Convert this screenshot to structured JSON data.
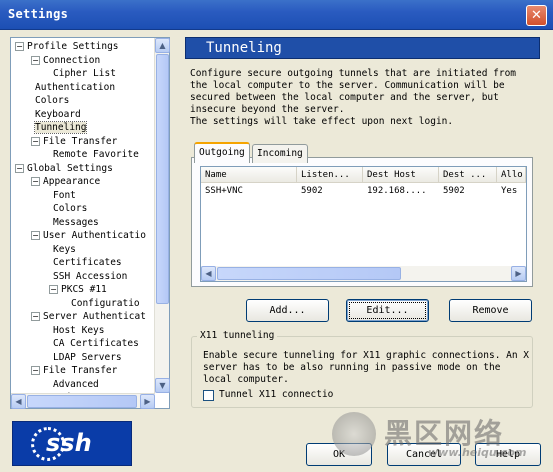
{
  "window": {
    "title": "Settings",
    "close_glyph": "✕"
  },
  "tree": {
    "items": [
      {
        "label": "Profile Settings",
        "expander": "−"
      },
      {
        "label": "Connection",
        "expander": "−"
      },
      {
        "label": "Cipher List",
        "expander": ""
      },
      {
        "label": "Authentication",
        "expander": ""
      },
      {
        "label": "Colors",
        "expander": ""
      },
      {
        "label": "Keyboard",
        "expander": ""
      },
      {
        "label": "Tunneling",
        "expander": "",
        "selected": true
      },
      {
        "label": "File Transfer",
        "expander": "−"
      },
      {
        "label": "Remote Favorite",
        "expander": ""
      },
      {
        "label": "Global Settings",
        "expander": "−"
      },
      {
        "label": "Appearance",
        "expander": "−"
      },
      {
        "label": "Font",
        "expander": ""
      },
      {
        "label": "Colors",
        "expander": ""
      },
      {
        "label": "Messages",
        "expander": ""
      },
      {
        "label": "User Authenticatio",
        "expander": "−"
      },
      {
        "label": "Keys",
        "expander": ""
      },
      {
        "label": "Certificates",
        "expander": ""
      },
      {
        "label": "SSH Accession",
        "expander": ""
      },
      {
        "label": "PKCS #11",
        "expander": "−"
      },
      {
        "label": "Configuratio",
        "expander": ""
      },
      {
        "label": "Server Authenticat",
        "expander": "−"
      },
      {
        "label": "Host Keys",
        "expander": ""
      },
      {
        "label": "CA Certificates",
        "expander": ""
      },
      {
        "label": "LDAP Servers",
        "expander": ""
      },
      {
        "label": "File Transfer",
        "expander": "−"
      },
      {
        "label": "Advanced",
        "expander": ""
      },
      {
        "label": "Mode",
        "expander": ""
      }
    ]
  },
  "logo": {
    "text": "ssh"
  },
  "panel": {
    "title": "Tunneling",
    "description": "Configure secure outgoing tunnels that are initiated from\nthe local computer to the server. Communication will be\nsecured between the local computer and the server, but\ninsecure beyond the server.\nThe settings will take effect upon next login."
  },
  "tabs": [
    {
      "label": "Outgoing",
      "active": true
    },
    {
      "label": "Incoming",
      "active": false
    }
  ],
  "table": {
    "columns": [
      "Name",
      "Listen...",
      "Dest Host",
      "Dest ...",
      "Allo"
    ],
    "rows": [
      [
        "SSH+VNC",
        "5902",
        "192.168....",
        "5902",
        "Yes"
      ]
    ]
  },
  "buttons": {
    "add": "Add...",
    "edit": "Edit...",
    "remove": "Remove"
  },
  "x11": {
    "legend": "X11 tunneling",
    "description": "Enable secure tunneling for X11 graphic connections. An X server has to be also running in passive mode on the local computer.",
    "checkbox_label": "Tunnel X11 connectio",
    "checked": false
  },
  "footer": {
    "ok": "OK",
    "cancel": "Cancel",
    "help": "Help"
  },
  "watermark": {
    "text": "黑区网络",
    "url": "www.heiqu.com"
  },
  "scroll_glyphs": {
    "up": "▲",
    "down": "▼",
    "left": "◀",
    "right": "▶"
  }
}
